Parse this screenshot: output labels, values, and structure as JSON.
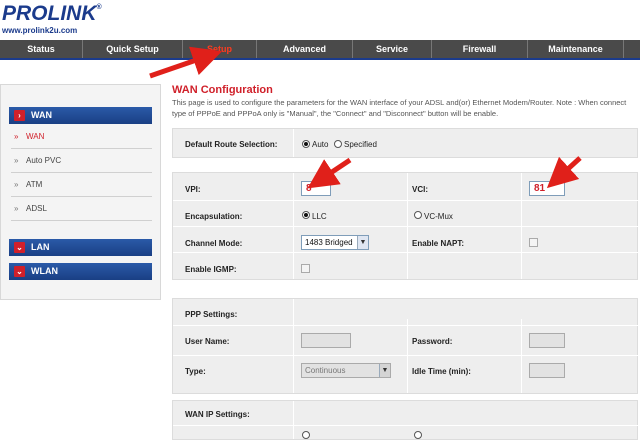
{
  "brand": {
    "logo": "PROLINK",
    "reg": "®",
    "url": "www.prolink2u.com"
  },
  "nav": [
    {
      "label": "Status"
    },
    {
      "label": "Quick Setup"
    },
    {
      "label": "Setup",
      "active": true
    },
    {
      "label": "Advanced"
    },
    {
      "label": "Service"
    },
    {
      "label": "Firewall"
    },
    {
      "label": "Maintenance"
    }
  ],
  "sidebar": {
    "wan_header": "WAN",
    "items": [
      "WAN",
      "Auto PVC",
      "ATM",
      "ADSL"
    ],
    "lan_header": "LAN",
    "wlan_header": "WLAN"
  },
  "page": {
    "title": "WAN Configuration",
    "description": "This page is used to configure the parameters for the WAN interface of your ADSL and(or) Ethernet Modem/Router. Note : When connect type of PPPoE and PPPoA only is \"Manual\", the \"Connect\" and \"Disconnect\" button will be enable."
  },
  "route": {
    "label": "Default Route Selection:",
    "option_auto": "Auto",
    "option_specified": "Specified",
    "selected": "Auto"
  },
  "atm": {
    "vpi_label": "VPI:",
    "vpi_value": "8",
    "vci_label": "VCI:",
    "vci_value": "81",
    "encap_label": "Encapsulation:",
    "encap_llc": "LLC",
    "encap_vcmux": "VC-Mux",
    "encap_selected": "LLC",
    "channel_label": "Channel Mode:",
    "channel_value": "1483 Bridged",
    "napt_label": "Enable NAPT:",
    "igmp_label": "Enable IGMP:"
  },
  "ppp": {
    "section_label": "PPP Settings:",
    "user_label": "User Name:",
    "password_label": "Password:",
    "type_label": "Type:",
    "type_value": "Continuous",
    "idle_label": "Idle Time (min):"
  },
  "wanip": {
    "section_label": "WAN IP Settings:"
  },
  "colors": {
    "accent_red": "#d0202a",
    "nav_bg": "#4a4a4a",
    "brand_blue": "#1b3b8c"
  }
}
